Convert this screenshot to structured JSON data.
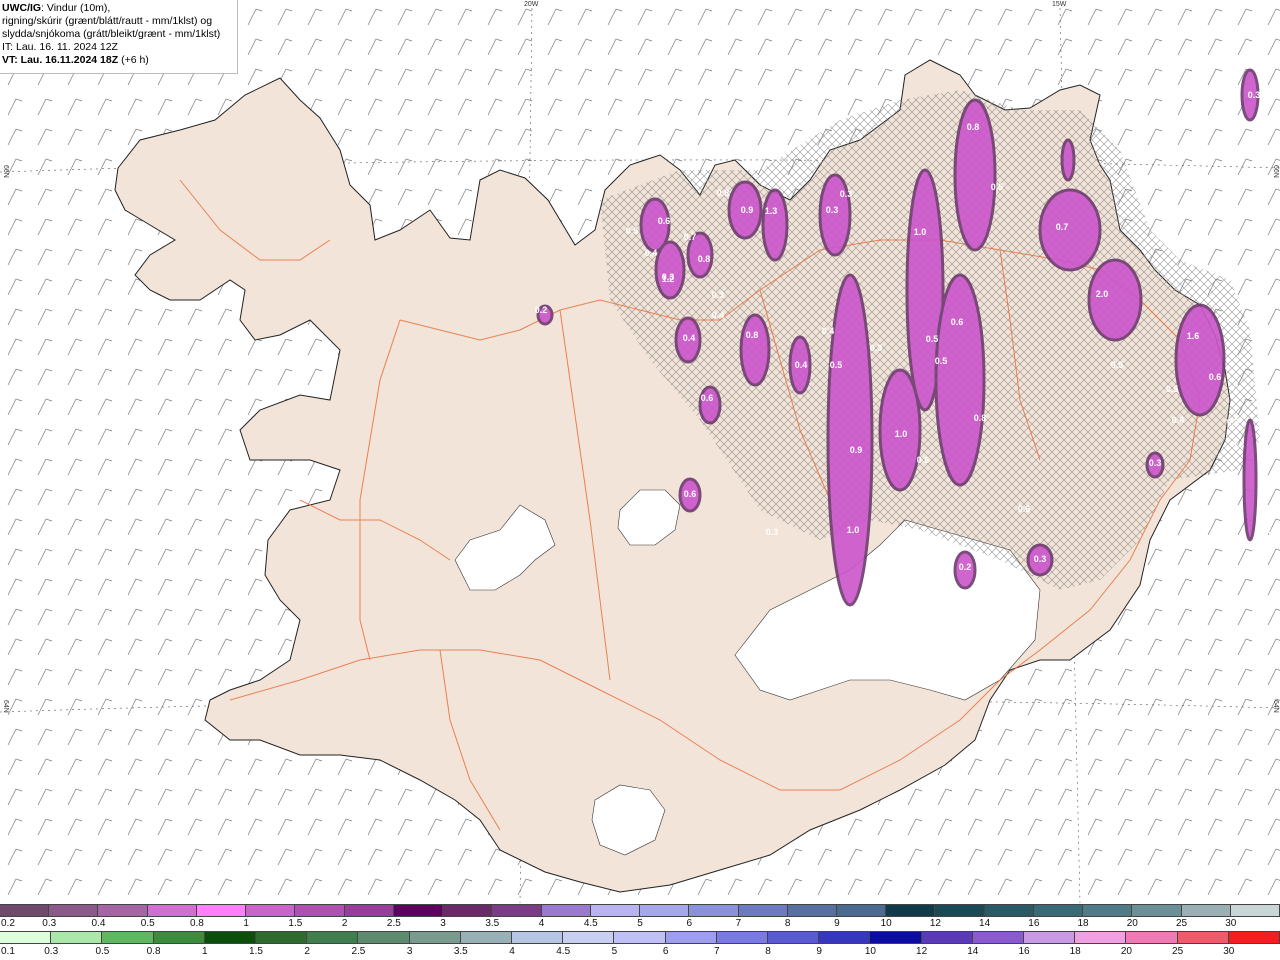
{
  "info": {
    "model": "UWC/IG",
    "line1_rest": ": Vindur (10m),",
    "line2": "rigning/skúrir (grænt/blátt/rautt - mm/1klst) og",
    "line3": "slydda/snjókoma (grátt/bleikt/grænt - mm/1klst)",
    "line4": "IT: Lau. 16. 11. 2024 12Z",
    "line5_bold": "VT: Lau. 16.11.2024 18Z",
    "line5_rest": " (+6 h)"
  },
  "graticule": {
    "lon_labels": [
      "20W",
      "15W"
    ],
    "lat_labels": [
      "66N",
      "64N",
      "66N",
      "64N"
    ]
  },
  "precip_labels": [
    "0.5",
    "0.6",
    "0.4",
    "0.3",
    "0.8",
    "0.9",
    "1.3",
    "0.3",
    "0.3",
    "0.7",
    "1.2",
    "0.8",
    "0.3",
    "0.4",
    "0.2",
    "0.4",
    "0.8",
    "1.0",
    "0.8",
    "0.5",
    "0.7",
    "2.0",
    "1.6",
    "0.5",
    "0.6",
    "0.4",
    "0.3",
    "0.4",
    "0.6",
    "0.4",
    "0.5",
    "0.3",
    "0.6",
    "0.5",
    "0.5",
    "0.8",
    "0.3",
    "0.6",
    "0.9",
    "1.0",
    "0.6",
    "0.2",
    "0.6",
    "0.3",
    "1.0",
    "0.5",
    "0.3",
    "0.2",
    "0.3",
    "0.2",
    "0.3"
  ],
  "legend_snow": {
    "labels": [
      "0.2",
      "0.3",
      "0.4",
      "0.5",
      "0.8",
      "1",
      "1.5",
      "2",
      "2.5",
      "3",
      "3.5",
      "4",
      "4.5",
      "5",
      "6",
      "7",
      "8",
      "9",
      "10",
      "12",
      "14",
      "16",
      "18",
      "20",
      "25",
      "30"
    ],
    "colors": [
      "#6e4a6c",
      "#8a5a88",
      "#a466a4",
      "#d16fd1",
      "#ff7fff",
      "#c965c9",
      "#b050b0",
      "#9a3c9a",
      "#5e005e",
      "#6a2a6a",
      "#7a3c84",
      "#9a7ad0",
      "#b8b4f0",
      "#a4a8e8",
      "#8a90dc",
      "#6c7ac4",
      "#5870a0",
      "#4a6a90",
      "#0f3c48",
      "#1a4a56",
      "#2a5a66",
      "#3a6a76",
      "#4f7c88",
      "#6c9098",
      "#9ab0b4",
      "#c9d6d8"
    ]
  },
  "legend_rain": {
    "labels": [
      "0.1",
      "0.3",
      "0.5",
      "0.8",
      "1",
      "1.5",
      "2",
      "2.5",
      "3",
      "3.5",
      "4",
      "4.5",
      "5",
      "6",
      "7",
      "8",
      "9",
      "10",
      "12",
      "14",
      "16",
      "18",
      "20",
      "25",
      "30"
    ],
    "colors": [
      "#ddffdd",
      "#aae8aa",
      "#5fb85f",
      "#3c8c3c",
      "#0a500a",
      "#2e6b2e",
      "#3f7f4f",
      "#5e8a6e",
      "#7a9a8e",
      "#9ab0b8",
      "#b6c6e2",
      "#c8d0f2",
      "#c0c0f8",
      "#9e9ef0",
      "#7a7ae4",
      "#5a5ad4",
      "#3636c0",
      "#0c0ca4",
      "#5a3ab8",
      "#8a5ad0",
      "#c89ae4",
      "#f0a0e0",
      "#f07ab4",
      "#f05a6a",
      "#f02020"
    ]
  },
  "colors": {
    "land": "#f2e4d8",
    "roads": "#e8703c",
    "coast": "#222222",
    "snow_hatch": "#888888",
    "precip": "#cc55cc"
  }
}
